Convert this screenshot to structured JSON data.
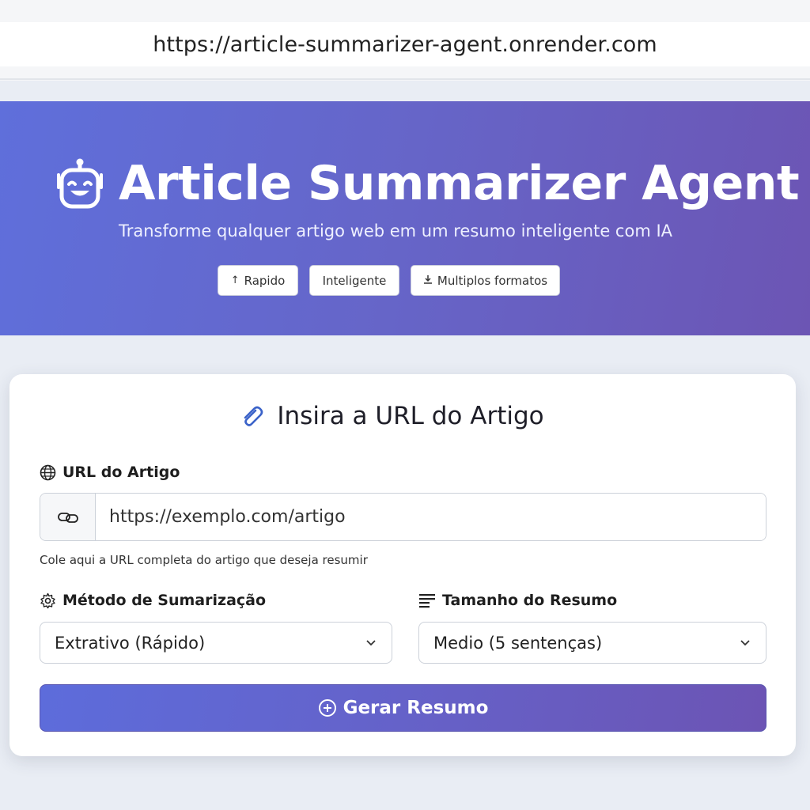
{
  "browser": {
    "url": "https://article-summarizer-agent.onrender.com"
  },
  "hero": {
    "icon": "robot-icon",
    "title": "Article Summarizer Agent",
    "subtitle": "Transforme qualquer artigo web em um resumo inteligente com IA",
    "badges": [
      {
        "icon": "arrow-up-icon",
        "label": "Rapido"
      },
      {
        "icon": "",
        "label": "Inteligente"
      },
      {
        "icon": "download-icon",
        "label": "Multiplos formatos"
      }
    ]
  },
  "form": {
    "title_icon": "paperclip-icon",
    "title": "Insira a URL do Artigo",
    "url_label": "URL do Artigo",
    "url_placeholder": "https://exemplo.com/artigo",
    "url_help": "Cole aqui a URL completa do artigo que deseja resumir",
    "method_label": "Método de Sumarização",
    "method_value": "Extrativo (Rápido)",
    "size_label": "Tamanho do Resumo",
    "size_value": "Medio (5 sentenças)",
    "submit_label": "Gerar Resumo"
  },
  "colors": {
    "brand_gradient_start": "#5f6fdb",
    "brand_gradient_end": "#6c55b4",
    "page_background": "#e9edf4",
    "clip_icon": "#3b63c9"
  }
}
